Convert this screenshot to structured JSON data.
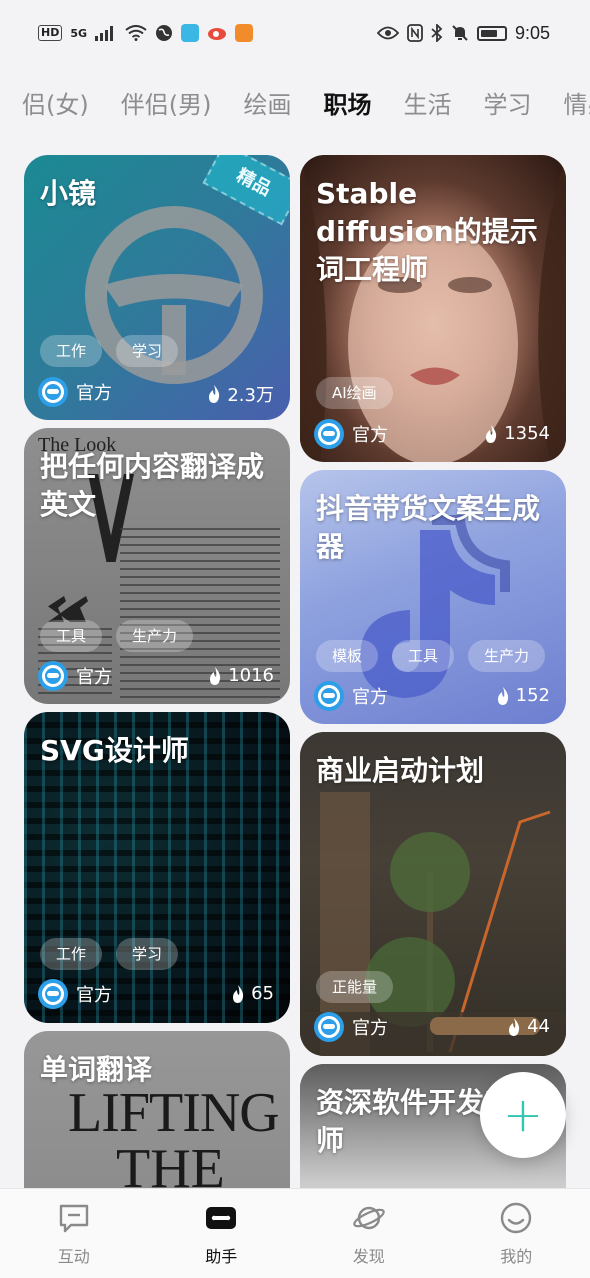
{
  "status_bar": {
    "left_labels": [
      "HD",
      "5G"
    ],
    "time": "9:05"
  },
  "tabs": [
    {
      "label": "侣(女)"
    },
    {
      "label": "伴侣(男)"
    },
    {
      "label": "绘画"
    },
    {
      "label": "职场"
    },
    {
      "label": "生活"
    },
    {
      "label": "学习"
    },
    {
      "label": "情感"
    }
  ],
  "active_tab": "职场",
  "cards": [
    {
      "title": "小镜",
      "badge": "精品",
      "tags": [
        "工作",
        "学习"
      ],
      "owner": "官方",
      "heat": "2.3万"
    },
    {
      "title": "Stable diffusion的提示词工程师",
      "tags": [
        "AI绘画"
      ],
      "owner": "官方",
      "heat": "1354"
    },
    {
      "title": "把任何内容翻译成英文",
      "tags": [
        "工具",
        "生产力"
      ],
      "owner": "官方",
      "heat": "1016",
      "bg_text": "The Look"
    },
    {
      "title": "抖音带货文案生成器",
      "tags": [
        "模板",
        "工具",
        "生产力"
      ],
      "owner": "官方",
      "heat": "152"
    },
    {
      "title": "SVG设计师",
      "tags": [
        "工作",
        "学习"
      ],
      "owner": "官方",
      "heat": "65"
    },
    {
      "title": "商业启动计划",
      "tags": [
        "正能量"
      ],
      "owner": "官方",
      "heat": "44"
    },
    {
      "title": "单词翻译",
      "bg_text": [
        "LIFTING",
        "THE"
      ]
    },
    {
      "title": "资深软件开发工程师"
    }
  ],
  "fab": {
    "symbol": "+"
  },
  "bottom_nav": [
    {
      "label": "互动",
      "icon": "chat-icon"
    },
    {
      "label": "助手",
      "icon": "robot-icon"
    },
    {
      "label": "发现",
      "icon": "planet-icon"
    },
    {
      "label": "我的",
      "icon": "smile-icon"
    }
  ],
  "colors": {
    "accent": "#31c6b4",
    "logo": "#2d9ee8"
  }
}
